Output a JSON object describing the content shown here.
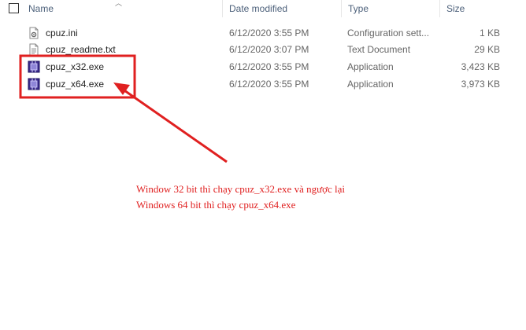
{
  "header": {
    "name": "Name",
    "date_modified": "Date modified",
    "type": "Type",
    "size": "Size"
  },
  "files": [
    {
      "name": "cpuz.ini",
      "date": "6/12/2020 3:55 PM",
      "type": "Configuration sett...",
      "size": "1 KB",
      "icon": "settings-file-icon"
    },
    {
      "name": "cpuz_readme.txt",
      "date": "6/12/2020 3:07 PM",
      "type": "Text Document",
      "size": "29 KB",
      "icon": "text-file-icon"
    },
    {
      "name": "cpuz_x32.exe",
      "date": "6/12/2020 3:55 PM",
      "type": "Application",
      "size": "3,423 KB",
      "icon": "cpuz-app-icon"
    },
    {
      "name": "cpuz_x64.exe",
      "date": "6/12/2020 3:55 PM",
      "type": "Application",
      "size": "3,973 KB",
      "icon": "cpuz-app-icon"
    }
  ],
  "annotation": {
    "line1": "Window 32 bit thì chạy cpuz_x32.exe và ngược lại",
    "line2": "Windows 64 bit thì chạy cpuz_x64.exe",
    "color": "#e02020"
  }
}
